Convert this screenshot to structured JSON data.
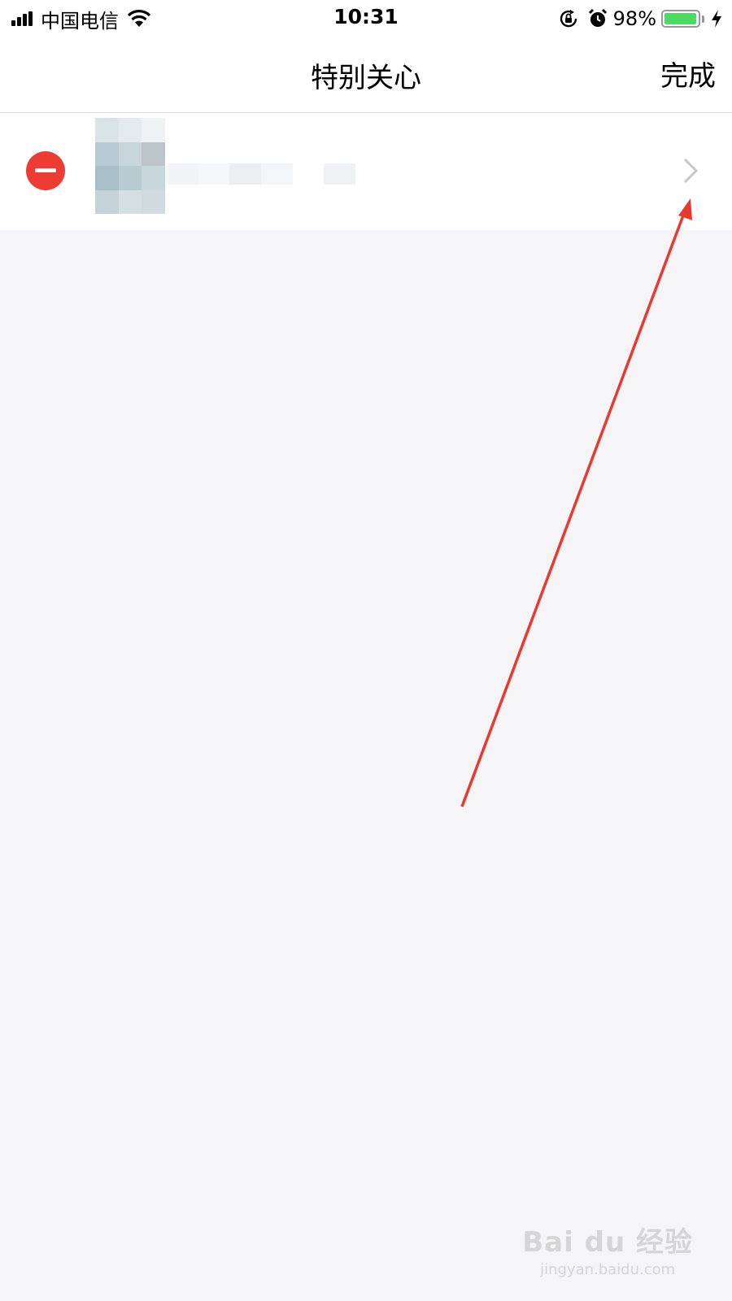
{
  "status_bar": {
    "carrier": "中国电信",
    "time": "10:31",
    "battery_percent": "98%",
    "battery_level": 0.98,
    "icons": [
      "cell-signal-icon",
      "wifi-icon",
      "orientation-lock-icon",
      "alarm-icon",
      "battery-icon",
      "charging-bolt-icon"
    ]
  },
  "nav": {
    "title": "特别关心",
    "done_label": "完成"
  },
  "list": {
    "items": [
      {
        "name_redacted": true,
        "icons": [
          "remove-circle-icon",
          "chevron-right-icon"
        ]
      }
    ]
  },
  "annotation": {
    "type": "red-arrow",
    "color": "#e83a30"
  },
  "watermark": {
    "brand": "Bai du 经验",
    "url": "jingyan.baidu.com"
  },
  "colors": {
    "remove": "#ee3c34",
    "battery": "#4cd964",
    "background": "#f5f5f7"
  }
}
